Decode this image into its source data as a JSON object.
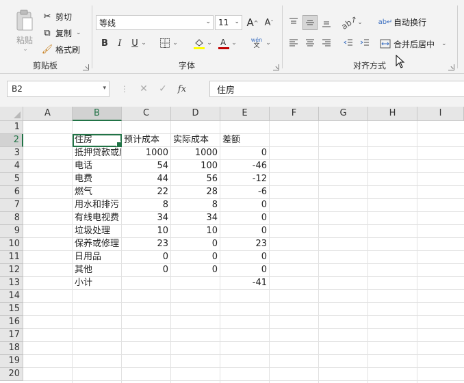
{
  "clipboard": {
    "paste_label": "粘贴",
    "cut_label": "剪切",
    "copy_label": "复制",
    "format_painter_label": "格式刷",
    "group_label": "剪贴板"
  },
  "font": {
    "font_name": "等线",
    "font_size": "11",
    "grow_label": "A",
    "shrink_label": "A",
    "bold": "B",
    "italic": "I",
    "underline": "U",
    "phonetic_top": "wén",
    "phonetic_bottom": "文",
    "group_label": "字体"
  },
  "alignment": {
    "wrap_text_label": "自动换行",
    "merge_center_label": "合并后居中",
    "group_label": "对齐方式"
  },
  "formula_bar": {
    "name_box": "B2",
    "formula_value": "住房",
    "fx_label": "fx"
  },
  "columns": [
    "A",
    "B",
    "C",
    "D",
    "E",
    "F",
    "G",
    "H",
    "I"
  ],
  "rows": [
    "1",
    "2",
    "3",
    "4",
    "5",
    "6",
    "7",
    "8",
    "9",
    "10",
    "11",
    "12",
    "13",
    "14",
    "15",
    "16",
    "17",
    "18",
    "19",
    "20"
  ],
  "sheet": {
    "r2": {
      "b": "住房",
      "c": "预计成本",
      "d": "实际成本",
      "e": "差额"
    },
    "r3": {
      "b": "抵押贷款或房租",
      "c": "1000",
      "d": "1000",
      "e": "0"
    },
    "r4": {
      "b": "电话",
      "c": "54",
      "d": "100",
      "e": "-46"
    },
    "r5": {
      "b": "电费",
      "c": "44",
      "d": "56",
      "e": "-12"
    },
    "r6": {
      "b": "燃气",
      "c": "22",
      "d": "28",
      "e": "-6"
    },
    "r7": {
      "b": "用水和排污",
      "c": "8",
      "d": "8",
      "e": "0"
    },
    "r8": {
      "b": "有线电视费",
      "c": "34",
      "d": "34",
      "e": "0"
    },
    "r9": {
      "b": "垃圾处理",
      "c": "10",
      "d": "10",
      "e": "0"
    },
    "r10": {
      "b": "保养或修理",
      "c": "23",
      "d": "0",
      "e": "23"
    },
    "r11": {
      "b": "日用品",
      "c": "0",
      "d": "0",
      "e": "0"
    },
    "r12": {
      "b": "其他",
      "c": "0",
      "d": "0",
      "e": "0"
    },
    "r13": {
      "b": "小计",
      "c": "",
      "d": "",
      "e": "-41"
    }
  },
  "colors": {
    "accent": "#217346",
    "font_color_bar": "#c00000",
    "fill_color_bar": "#ffff00"
  }
}
